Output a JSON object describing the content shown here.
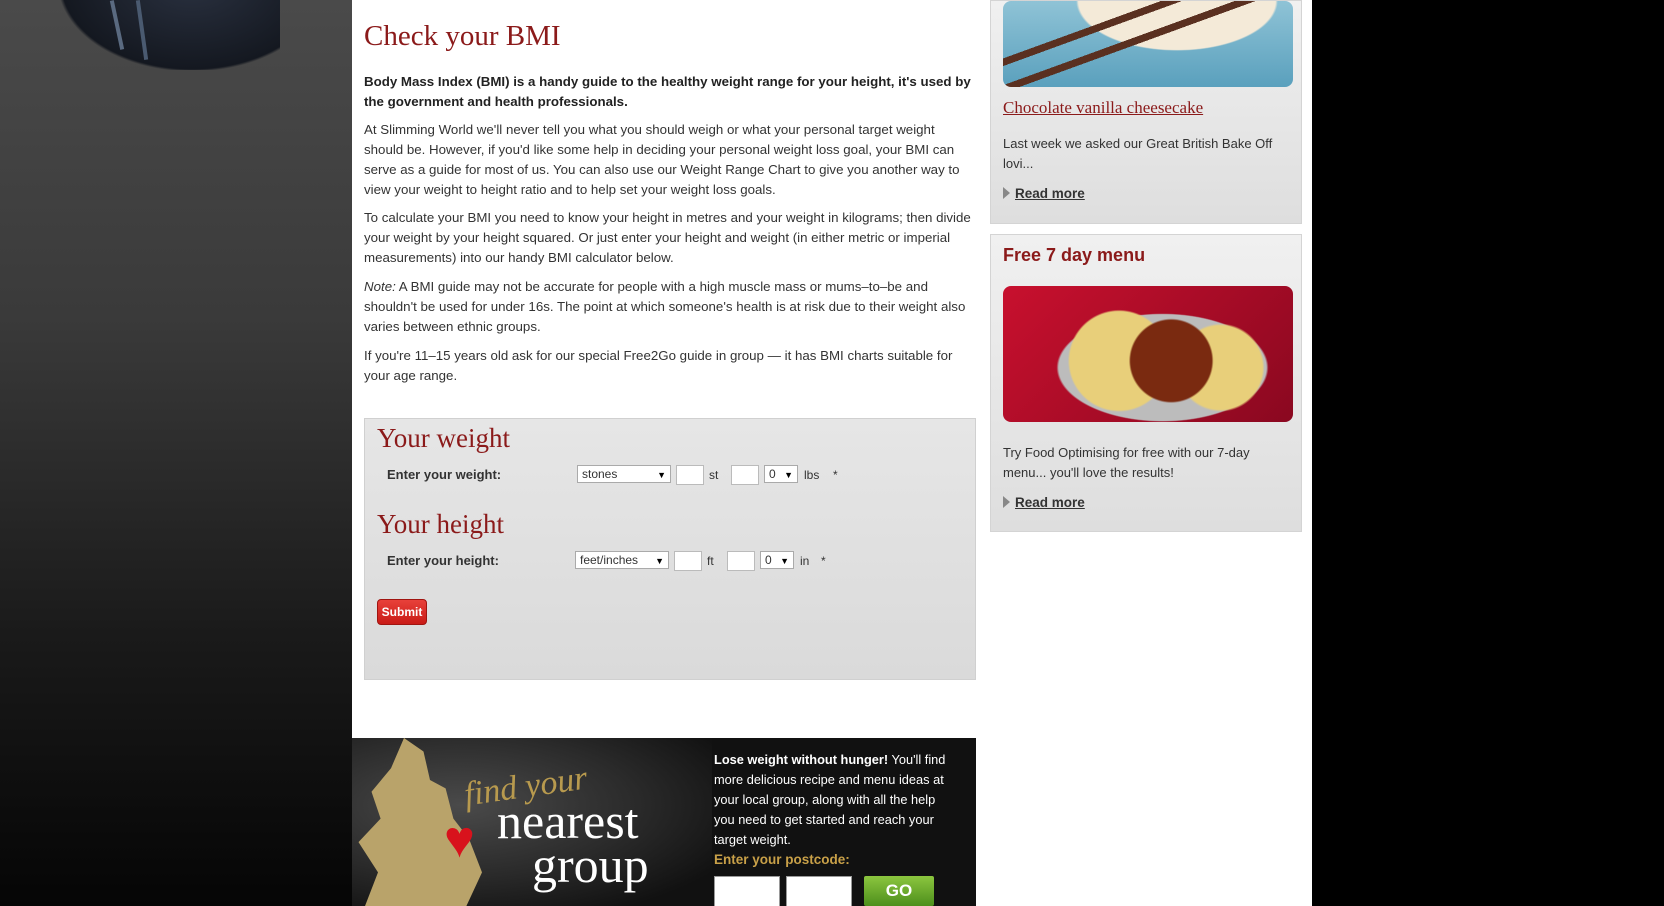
{
  "main": {
    "title": "Check your BMI",
    "intro": "Body Mass Index (BMI) is a handy guide to the healthy weight range for your height, it's used by the government and health professionals.",
    "para1": "At Slimming World we'll never tell you what you should weigh or what your personal target weight should be. However, if you'd like some help in deciding your personal weight loss goal, your BMI can serve as a guide for most of us. You can also use our Weight Range Chart to give you another way to view your weight to height ratio and to help set your weight loss goals.",
    "para2": "To calculate your BMI you need to know your height in metres and your weight in kilograms; then divide your weight by your height squared. Or just enter your height and weight (in either metric or imperial measurements) into our handy BMI calculator below.",
    "note_label": "Note:",
    "para3": " A BMI guide may not be accurate for people with a high muscle mass or mums–to–be and shouldn't be used for under 16s. The point at which someone's health is at risk due to their weight also varies between ethnic groups.",
    "para4": "If you're 11–15 years old ask for our special Free2Go guide in group — it has BMI charts suitable for your age range."
  },
  "calculator": {
    "weight_heading": "Your weight",
    "weight_label": "Enter your weight:",
    "weight_unit_select": "stones",
    "weight_unit_st": "st",
    "weight_lbs_select": "0",
    "weight_unit_lbs": "lbs",
    "weight_required": "*",
    "height_heading": "Your height",
    "height_label": "Enter your height:",
    "height_unit_select": "feet/inches",
    "height_unit_ft": "ft",
    "height_in_select": "0",
    "height_unit_in": "in",
    "height_required": "*",
    "submit_label": "Submit"
  },
  "banner": {
    "find_your": "find your",
    "nearest": "nearest",
    "group": "group",
    "lead_bold": "Lose weight without hunger!",
    "lead_text": " You'll find more delicious recipe and menu ideas at your local group, along with all the help you need to get started and reach your target weight.",
    "postcode_label": "Enter your postcode:",
    "go_label": "GO"
  },
  "sidebar": {
    "card1": {
      "title": "Chocolate vanilla cheesecake",
      "text": "Last week we asked our Great British Bake Off lovi...",
      "read_more": "Read more"
    },
    "card2": {
      "title": "Free 7 day menu",
      "text": "Try Food Optimising for free with our 7-day menu... you'll love the results!",
      "read_more": "Read more"
    }
  }
}
